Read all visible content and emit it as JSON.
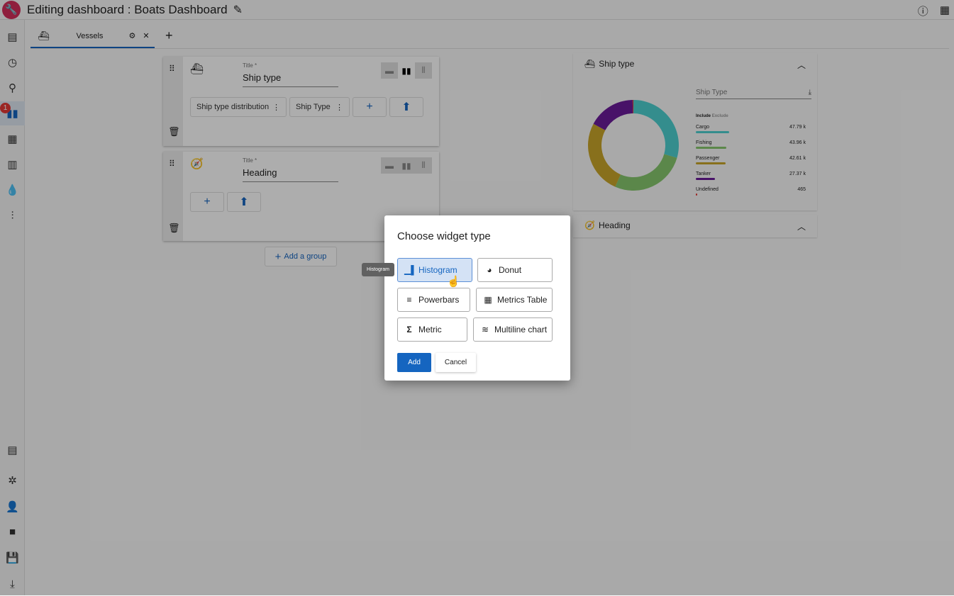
{
  "header": {
    "title": "Editing dashboard : Boats Dashboard",
    "icons": [
      "app-logo",
      "edit-icon",
      "info-icon",
      "apps-grid-icon"
    ]
  },
  "sidebar": {
    "items": [
      "map",
      "history",
      "search",
      "widgets",
      "table",
      "columns",
      "drop",
      "filters",
      "library",
      "graph",
      "user-settings",
      "folder",
      "save",
      "download"
    ],
    "badge": "1"
  },
  "tabs": [
    {
      "label": "Vessels"
    }
  ],
  "groups": [
    {
      "title_label": "Title *",
      "title": "Ship type",
      "widgets": [
        "Ship type distribution",
        "Ship Type"
      ]
    },
    {
      "title_label": "Title *",
      "title": "Heading",
      "widgets": []
    }
  ],
  "add_group": "Add a group",
  "preview": {
    "ship_type": {
      "title": "Ship type",
      "field": "Ship Type",
      "include": "Include",
      "exclude": "Exclude",
      "items": [
        {
          "label": "Cargo",
          "value": "47.79 k",
          "color": "#4dd0d0"
        },
        {
          "label": "Fishing",
          "value": "43.96 k",
          "color": "#86c76e"
        },
        {
          "label": "Passenger",
          "value": "42.61 k",
          "color": "#c9a62a"
        },
        {
          "label": "Tanker",
          "value": "27.37 k",
          "color": "#6a1b9a"
        },
        {
          "label": "Undefined",
          "value": "465",
          "color": "#e53935"
        }
      ]
    },
    "heading": {
      "title": "Heading"
    }
  },
  "chart_data": {
    "type": "pie",
    "categories": [
      "Cargo",
      "Fishing",
      "Passenger",
      "Tanker",
      "Undefined"
    ],
    "values": [
      47790,
      43960,
      42610,
      27370,
      465
    ]
  },
  "dialog": {
    "title": "Choose widget type",
    "options": [
      "Histogram",
      "Donut",
      "Powerbars",
      "Metrics Table",
      "Metric",
      "Multiline chart"
    ],
    "selected": "Histogram",
    "add": "Add",
    "cancel": "Cancel",
    "tooltip": "Histogram"
  }
}
